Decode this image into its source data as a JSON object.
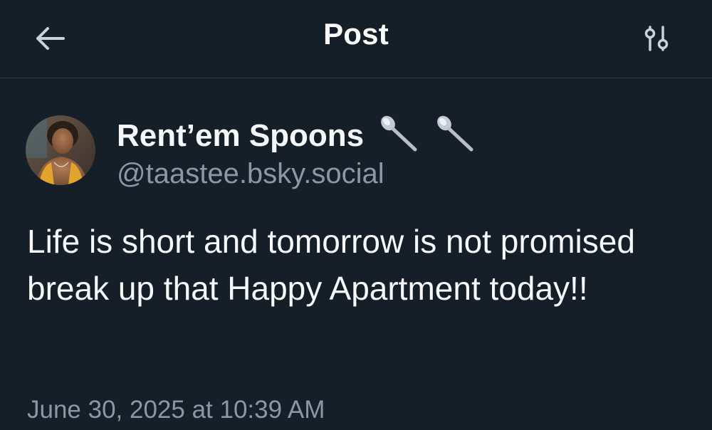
{
  "header": {
    "title": "Post",
    "back_icon": "arrow-left-icon",
    "filter_icon": "sliders-icon"
  },
  "author": {
    "display_name": "Rent’em Spoons",
    "name_emoji": "spoon-icon",
    "handle": "@taastee.bsky.social"
  },
  "post": {
    "text": "Life is short and tomorrow is not promised break up that Happy Apartment today!!",
    "timestamp": "June 30, 2025 at 10:39 AM"
  },
  "colors": {
    "background": "#161e27",
    "text_primary": "#f5f7f9",
    "text_secondary": "#8a97a6",
    "divider": "#2e3a47"
  }
}
